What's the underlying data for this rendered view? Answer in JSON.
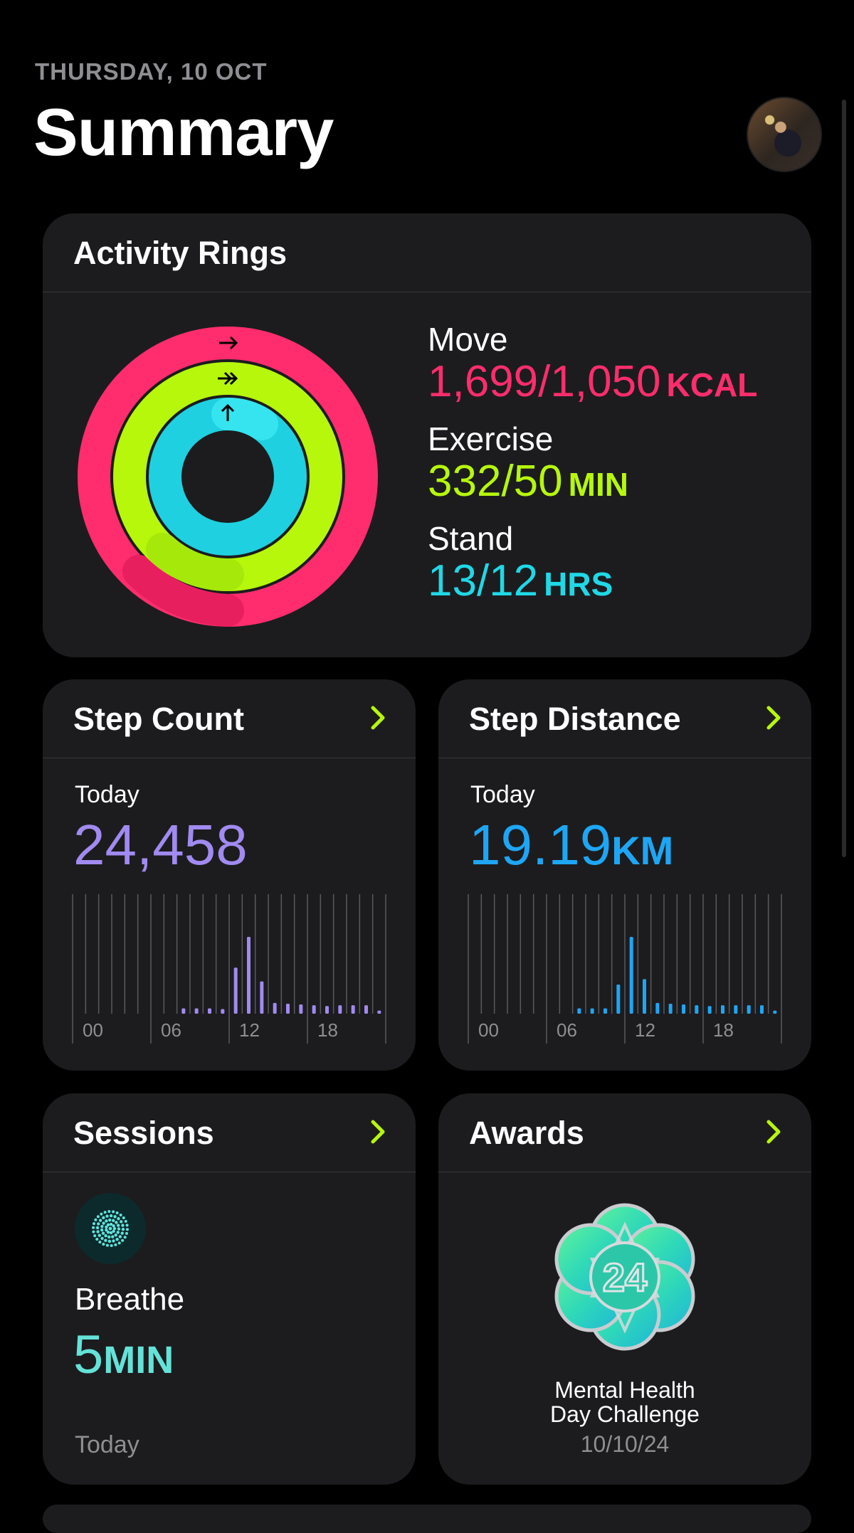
{
  "header": {
    "date": "THURSDAY, 10 OCT",
    "title": "Summary"
  },
  "activity_rings": {
    "title": "Activity Rings",
    "move": {
      "label": "Move",
      "value": "1,699/1,050",
      "unit": "KCAL",
      "color": "#ff2d6d",
      "progress": 1.618
    },
    "exercise": {
      "label": "Exercise",
      "value": "332/50",
      "unit": "MIN",
      "color": "#b6f70b",
      "progress": 6.64
    },
    "stand": {
      "label": "Stand",
      "value": "13/12",
      "unit": "HRS",
      "color": "#20d8e6",
      "progress": 1.083
    }
  },
  "step_count": {
    "title": "Step Count",
    "period_label": "Today",
    "value": "24,458",
    "color": "#a18af0",
    "chart": {
      "x_ticks": [
        "00",
        "06",
        "12",
        "18"
      ],
      "hourly_relative": [
        0,
        0,
        0,
        0,
        0,
        0,
        0,
        0,
        0.07,
        0.07,
        0.07,
        0.06,
        0.6,
        1.0,
        0.42,
        0.14,
        0.13,
        0.12,
        0.11,
        0.1,
        0.11,
        0.11,
        0.11,
        0.04
      ]
    }
  },
  "step_distance": {
    "title": "Step Distance",
    "period_label": "Today",
    "value": "19.19",
    "unit": "KM",
    "color": "#1ea6f5",
    "chart": {
      "x_ticks": [
        "00",
        "06",
        "12",
        "18"
      ],
      "hourly_relative": [
        0,
        0,
        0,
        0,
        0,
        0,
        0,
        0,
        0.07,
        0.07,
        0.07,
        0.38,
        1.0,
        0.45,
        0.14,
        0.13,
        0.12,
        0.11,
        0.1,
        0.11,
        0.11,
        0.11,
        0.11,
        0.04
      ]
    }
  },
  "sessions": {
    "title": "Sessions",
    "name": "Breathe",
    "value": "5",
    "unit": "MIN",
    "date": "Today"
  },
  "awards": {
    "title": "Awards",
    "award_line1": "Mental Health",
    "award_line2": "Day Challenge",
    "date": "10/10/24",
    "badge_label": "24"
  },
  "colors": {
    "background": "#000000",
    "card": "#1c1c1e",
    "chevron": "#b6f70b",
    "secondary_text": "#8e8e93"
  }
}
